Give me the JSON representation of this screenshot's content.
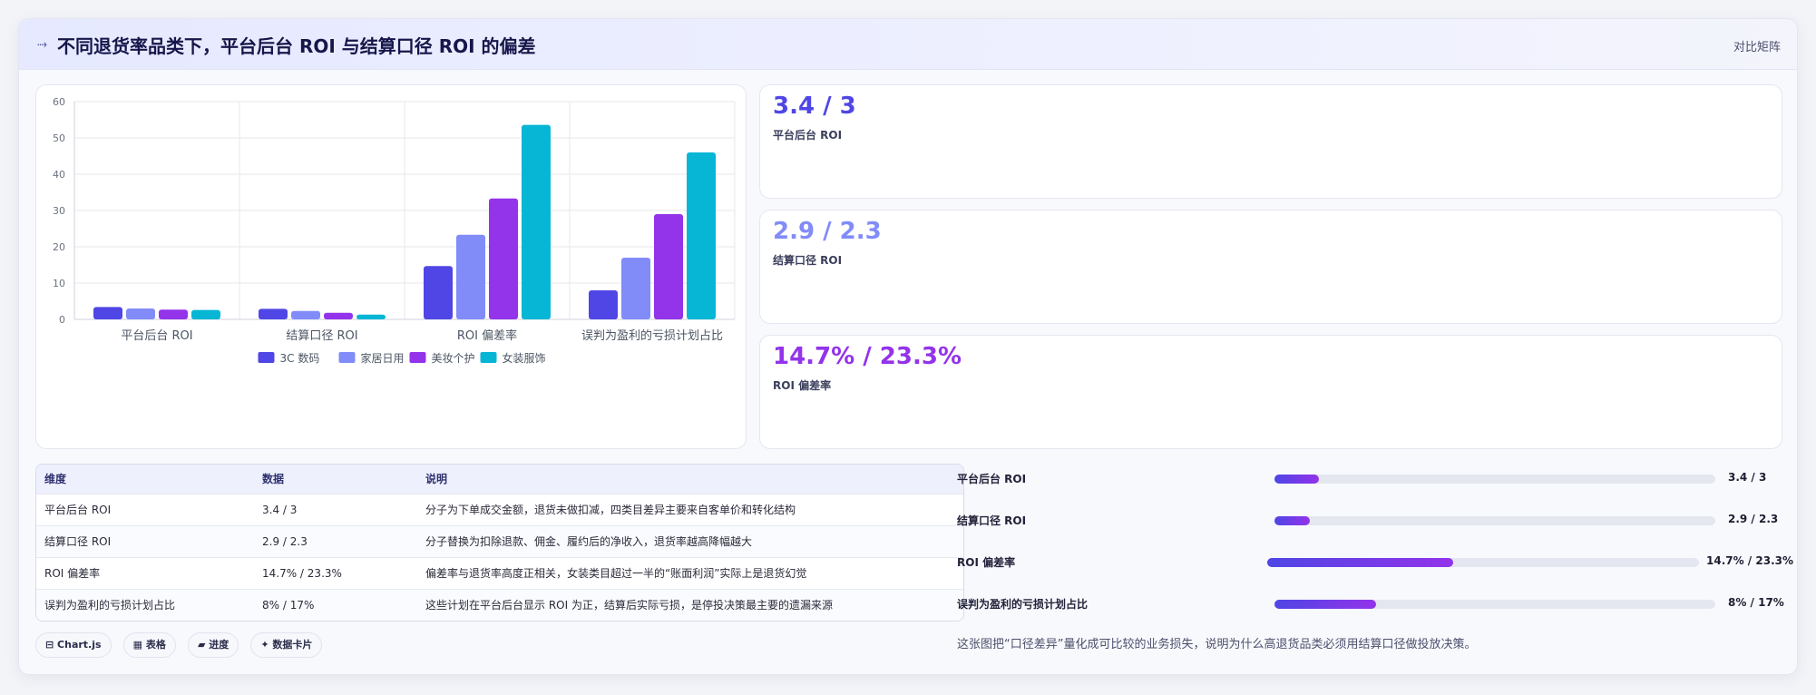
{
  "header": {
    "icon": "trend-arrow-icon",
    "title": "不同退货率品类下，平台后台 ROI 与结算口径 ROI 的偏差",
    "right_link": "对比矩阵"
  },
  "colors": {
    "series": [
      "#4f46e5",
      "#818cf8",
      "#9333ea",
      "#06b6d4"
    ]
  },
  "chart_data": {
    "type": "bar",
    "categories": [
      "平台后台 ROI",
      "结算口径 ROI",
      "ROI 偏差率",
      "误判为盈利的亏损计划占比"
    ],
    "series": [
      {
        "name": "3C 数码",
        "values": [
          3.4,
          2.9,
          14.7,
          8
        ]
      },
      {
        "name": "家居日用",
        "values": [
          3.0,
          2.3,
          23.3,
          17
        ]
      },
      {
        "name": "美妆个护",
        "values": [
          2.7,
          1.8,
          33.3,
          29
        ]
      },
      {
        "name": "女装服饰",
        "values": [
          2.6,
          1.3,
          53.6,
          46
        ]
      }
    ],
    "ylim": [
      0,
      60
    ],
    "yticks": [
      0,
      10,
      20,
      30,
      40,
      50,
      60
    ],
    "legend_position": "bottom",
    "grid": true
  },
  "kpis": [
    {
      "value": "3.4 / 3",
      "label": "平台后台 ROI",
      "color": "#4f46e5"
    },
    {
      "value": "2.9 / 2.3",
      "label": "结算口径 ROI",
      "color": "#818cf8"
    },
    {
      "value": "14.7% / 23.3%",
      "label": "ROI 偏差率",
      "color": "#9333ea"
    }
  ],
  "table": {
    "headers": [
      "维度",
      "数据",
      "说明"
    ],
    "rows": [
      [
        "平台后台 ROI",
        "3.4 / 3",
        "分子为下单成交金额，退货未做扣减，四类目差异主要来自客单价和转化结构"
      ],
      [
        "结算口径 ROI",
        "2.9 / 2.3",
        "分子替换为扣除退款、佣金、履约后的净收入，退货率越高降幅越大"
      ],
      [
        "ROI 偏差率",
        "14.7% / 23.3%",
        "偏差率与退货率高度正相关，女装类目超过一半的“账面利润”实际上是退货幻觉"
      ],
      [
        "误判为盈利的亏损计划占比",
        "8% / 17%",
        "这些计划在平台后台显示 ROI 为正，结算后实际亏损，是停投决策最主要的遗漏来源"
      ]
    ]
  },
  "tags": [
    "⊟ Chart.js",
    "▦ 表格",
    "▰ 进度",
    "✦ 数据卡片"
  ],
  "progress": [
    {
      "label": "平台后台 ROI",
      "value": "3.4 / 3",
      "fraction": 0.1
    },
    {
      "label": "结算口径 ROI",
      "value": "2.9 / 2.3",
      "fraction": 0.08
    },
    {
      "label": "ROI 偏差率",
      "value": "14.7% / 23.3%",
      "fraction": 0.43
    },
    {
      "label": "误判为盈利的亏损计划占比",
      "value": "8% / 17%",
      "fraction": 0.23
    }
  ],
  "note": "这张图把“口径差异”量化成可比较的业务损失，说明为什么高退货品类必须用结算口径做投放决策。"
}
